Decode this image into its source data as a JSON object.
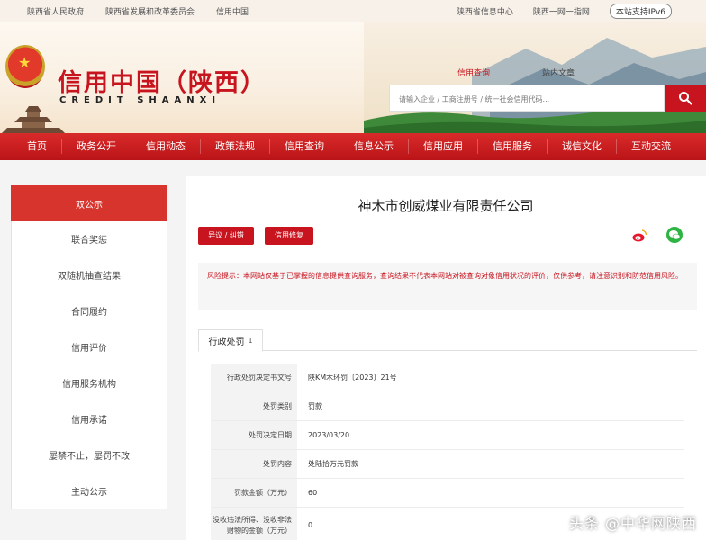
{
  "topbar": {
    "left_links": [
      "陕西省人民政府",
      "陕西省发展和改革委员会",
      "信用中国"
    ],
    "right_links": [
      "陕西省信息中心",
      "陕西一网一指网"
    ],
    "ipv6": "本站支持IPv6"
  },
  "header": {
    "title_cn": "信用中国（陕西）",
    "title_en": "CREDIT SHAANXI",
    "search_tab_active": "信用查询",
    "search_tab_other": "站内文章",
    "search_placeholder": "请输入企业 / 工商注册号 / 统一社会信用代码..."
  },
  "nav": [
    "首页",
    "政务公开",
    "信用动态",
    "政策法规",
    "信用查询",
    "信息公示",
    "信用应用",
    "信用服务",
    "诚信文化",
    "互动交流"
  ],
  "sidebar": [
    {
      "label": "双公示",
      "active": true
    },
    {
      "label": "联合奖惩"
    },
    {
      "label": "双随机抽查结果"
    },
    {
      "label": "合同履约"
    },
    {
      "label": "信用评价"
    },
    {
      "label": "信用服务机构"
    },
    {
      "label": "信用承诺"
    },
    {
      "label": "屡禁不止，屡罚不改"
    },
    {
      "label": "主动公示"
    }
  ],
  "main": {
    "company": "神木市创威煤业有限责任公司",
    "btn_objection": "异议 / 纠错",
    "btn_repair": "信用修复",
    "notice": "风险提示：本网站仅基于已掌握的信息提供查询服务，查询结果不代表本网站对被查询对象信用状况的评价，仅供参考，请注意识别和防范信用风险。",
    "tab_label": "行政处罚",
    "tab_count": "1",
    "rows": [
      {
        "label": "行政处罚决定书文号",
        "value": "陕KM木环罚〔2023〕21号"
      },
      {
        "label": "处罚类别",
        "value": "罚款"
      },
      {
        "label": "处罚决定日期",
        "value": "2023/03/20"
      },
      {
        "label": "处罚内容",
        "value": "处陆拾万元罚款"
      },
      {
        "label": "罚款金额（万元）",
        "value": "60"
      },
      {
        "label": "没收违法所得、没收非法财物的金额（万元）",
        "value": "0"
      }
    ]
  },
  "watermark": "头条 @中华网陕西",
  "colors": {
    "brand_red": "#c8141f",
    "nav_red": "#cc1e22",
    "wechat_green": "#2db443"
  }
}
